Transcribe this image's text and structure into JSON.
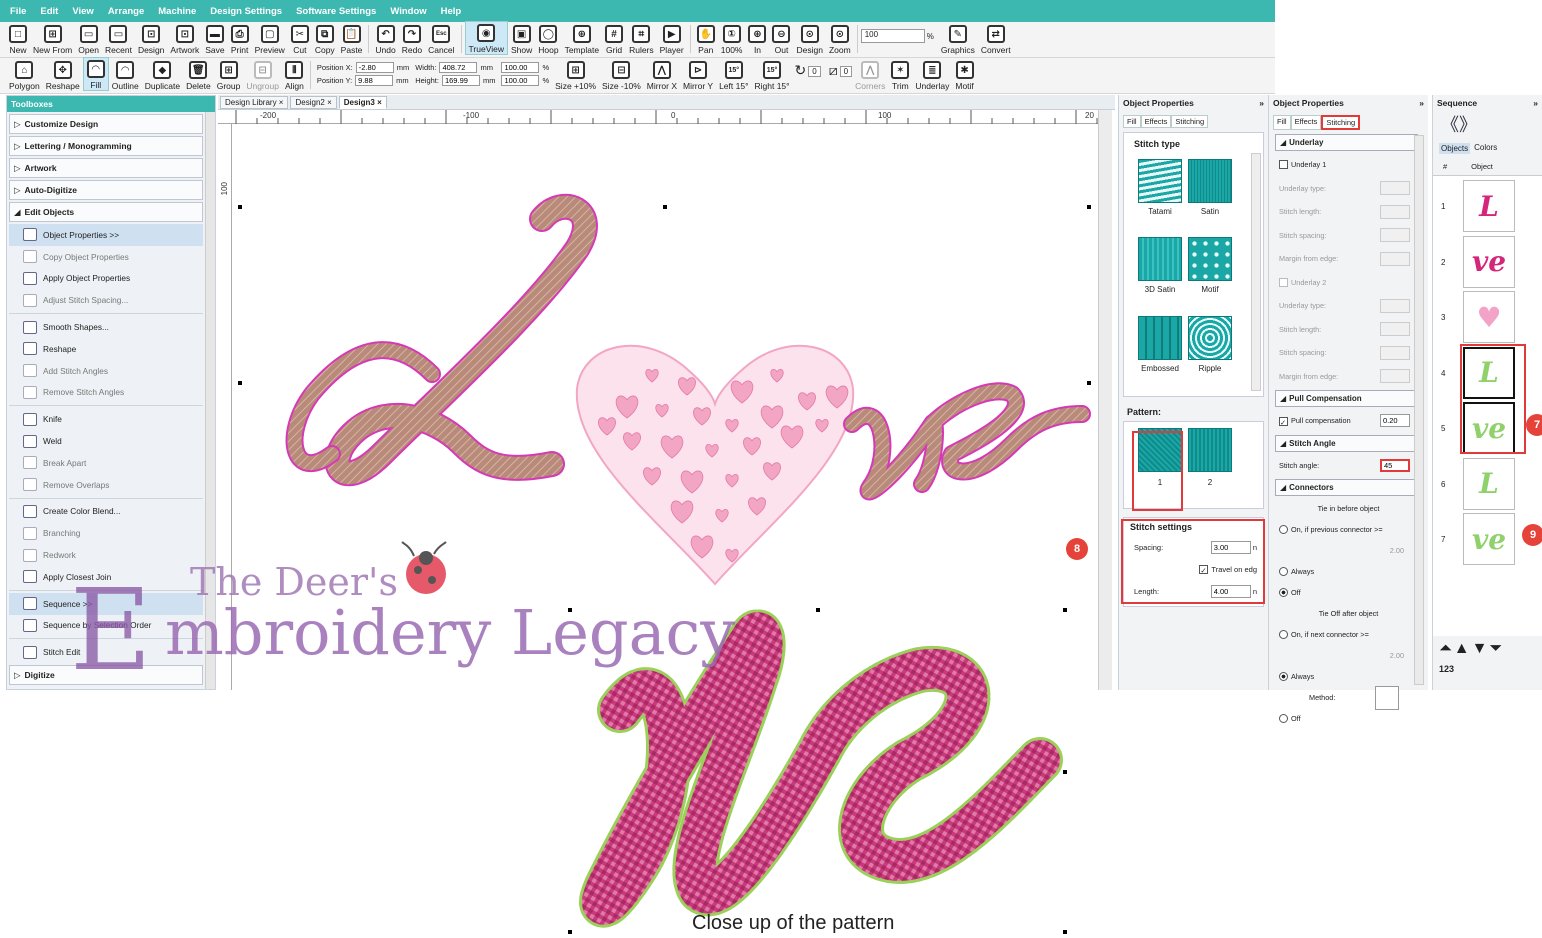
{
  "menu": [
    "File",
    "Edit",
    "View",
    "Arrange",
    "Machine",
    "Design Settings",
    "Software Settings",
    "Window",
    "Help"
  ],
  "toolbar1": {
    "tools": [
      "New",
      "New From",
      "Open",
      "Recent",
      "Design",
      "Artwork",
      "Save",
      "Print",
      "Preview",
      "Cut",
      "Copy",
      "Paste",
      "Undo",
      "Redo",
      "Cancel",
      "TrueView",
      "Show",
      "Hoop",
      "Template",
      "Grid",
      "Rulers",
      "Player",
      "Pan",
      "100%",
      "In",
      "Out",
      "Design",
      "Zoom",
      "Graphics",
      "Convert"
    ],
    "cancel_key": "Esc",
    "zoom_value": "100",
    "zoom_unit": "%"
  },
  "toolbar2": {
    "tools_left": [
      "Polygon",
      "Reshape",
      "Fill",
      "Outline",
      "Duplicate",
      "Delete",
      "Group",
      "Ungroup",
      "Align"
    ],
    "position_x_label": "Position X:",
    "position_x": "-2.80",
    "position_y_label": "Position Y:",
    "position_y": "9.88",
    "width_label": "Width:",
    "width": "408.72",
    "height_label": "Height:",
    "height": "169.99",
    "unit_mm": "mm",
    "scale_w": "100.00",
    "scale_h": "100.00",
    "unit_pct": "%",
    "tools_right": [
      "Size +10%",
      "Size -10%",
      "Mirror X",
      "Mirror Y",
      "Left 15°",
      "Right 15°",
      "Corners",
      "Trim",
      "Underlay",
      "Motif"
    ],
    "angle_value_1": "0",
    "angle_value_2": "0",
    "deg_15": "15°"
  },
  "toolboxes": {
    "title": "Toolboxes",
    "categories_top": [
      "Customize Design",
      "Lettering / Monogramming",
      "Artwork",
      "Auto-Digitize",
      "Edit Objects"
    ],
    "items": [
      {
        "label": "Object Properties >>",
        "dim": false,
        "sel": true
      },
      {
        "label": "Copy Object Properties",
        "dim": true
      },
      {
        "label": "Apply Object Properties",
        "dim": false
      },
      {
        "label": "Adjust Stitch Spacing...",
        "dim": true
      },
      {
        "label": "Smooth Shapes...",
        "dim": false
      },
      {
        "label": "Reshape",
        "dim": false
      },
      {
        "label": "Add Stitch Angles",
        "dim": true
      },
      {
        "label": "Remove Stitch Angles",
        "dim": true
      },
      {
        "label": "Knife",
        "dim": false
      },
      {
        "label": "Weld",
        "dim": false
      },
      {
        "label": "Break Apart",
        "dim": true
      },
      {
        "label": "Remove Overlaps",
        "dim": true
      },
      {
        "label": "Create Color Blend...",
        "dim": false
      },
      {
        "label": "Branching",
        "dim": true
      },
      {
        "label": "Redwork",
        "dim": true
      },
      {
        "label": "Apply Closest Join",
        "dim": false
      },
      {
        "label": "Sequence >>",
        "dim": false,
        "sel": true
      },
      {
        "label": "Sequence by Selection Order",
        "dim": false
      },
      {
        "label": "Stitch Edit",
        "dim": false
      }
    ],
    "category_bottom": "Digitize"
  },
  "design_tabs": [
    "Design Library",
    "Design2",
    "Design3"
  ],
  "ruler_labels": [
    "-200",
    "-100",
    "0",
    "100",
    "20"
  ],
  "ruler_v_label": "100",
  "object_properties_left": {
    "title": "Object Properties",
    "tabs": [
      "Fill",
      "Effects",
      "Stitching"
    ],
    "stitch_type_title": "Stitch type",
    "stitch_types": [
      "Tatami",
      "Satin",
      "3D Satin",
      "Motif",
      "Embossed",
      "Ripple"
    ],
    "pattern_title": "Pattern:",
    "patterns": [
      "1",
      "2"
    ],
    "stitch_settings_title": "Stitch settings",
    "spacing_label": "Spacing:",
    "spacing_value": "3.00",
    "travel_label": "Travel on edg",
    "length_label": "Length:",
    "length_value": "4.00",
    "unit_n": "n"
  },
  "object_properties_right": {
    "title": "Object Properties",
    "tabs": [
      "Fill",
      "Effects",
      "Stitching"
    ],
    "underlay_title": "Underlay",
    "underlay1": "Underlay 1",
    "underlay2": "Underlay 2",
    "underlay_rows": [
      "Underlay type:",
      "Stitch length:",
      "Stitch spacing:",
      "Margin from edge:"
    ],
    "pull_comp_title": "Pull Compensation",
    "pull_comp_label": "Pull compensation",
    "pull_comp_value": "0.20",
    "stitch_angle_title": "Stitch Angle",
    "stitch_angle_label": "Stitch angle:",
    "stitch_angle_value": "45",
    "connectors_title": "Connectors",
    "tie_in": "Tie in before object",
    "on_prev": "On, if previous connector >=",
    "val_200": "2.00",
    "always": "Always",
    "off": "Off",
    "tie_off": "Tie Off after object",
    "on_next": "On, if next connector >=",
    "method": "Method:"
  },
  "sequence": {
    "title": "Sequence",
    "tabs": [
      "Objects",
      "Colors"
    ],
    "col_num": "#",
    "col_obj": "Object",
    "items": [
      {
        "n": "1",
        "glyph": "L",
        "color": "#d4267a"
      },
      {
        "n": "2",
        "glyph": "ve",
        "color": "#d4267a"
      },
      {
        "n": "3",
        "glyph": "♥",
        "color": "#f3a3c7"
      },
      {
        "n": "4",
        "glyph": "L",
        "color": "#8fd16a"
      },
      {
        "n": "5",
        "glyph": "ve",
        "color": "#8fd16a"
      },
      {
        "n": "6",
        "glyph": "L",
        "color": "#8fd16a"
      },
      {
        "n": "7",
        "glyph": "ve",
        "color": "#8fd16a"
      }
    ],
    "footer": "123"
  },
  "badges": [
    "8",
    "7",
    "9"
  ],
  "watermark": {
    "line1": "The Deer's",
    "big": "E",
    "line2": "mbroidery Legacy"
  },
  "caption": "Close up of the pattern",
  "colors": {
    "accent": "#3cb8b0",
    "highlight": "#e03a3a",
    "fill_teal": "#1aa7a6",
    "stitch_brown": "#b88a7a",
    "outline_pink": "#d43ab5",
    "heart_pink": "#f2a6c4",
    "pattern_pink": "#c93a7c",
    "pattern_green": "#9bd15a"
  }
}
